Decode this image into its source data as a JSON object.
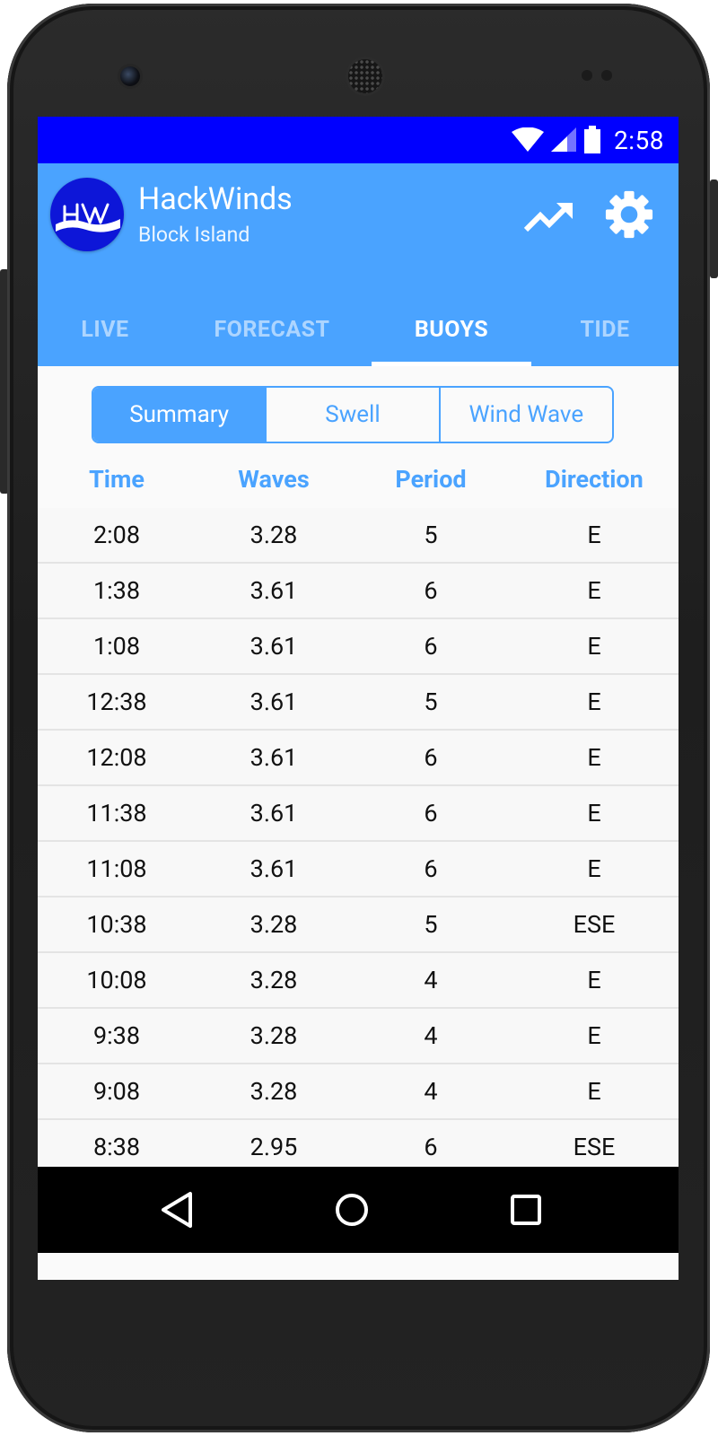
{
  "status_bar": {
    "time": "2:58"
  },
  "app": {
    "title": "HackWinds",
    "subtitle": "Block Island"
  },
  "tabs": [
    {
      "label": "LIVE",
      "active": false
    },
    {
      "label": "FORECAST",
      "active": false
    },
    {
      "label": "BUOYS",
      "active": true
    },
    {
      "label": "TIDE",
      "active": false
    }
  ],
  "segments": [
    {
      "label": "Summary",
      "active": true
    },
    {
      "label": "Swell",
      "active": false
    },
    {
      "label": "Wind Wave",
      "active": false
    }
  ],
  "table": {
    "headers": [
      "Time",
      "Waves",
      "Period",
      "Direction"
    ],
    "rows": [
      [
        "2:08",
        "3.28",
        "5",
        "E"
      ],
      [
        "1:38",
        "3.61",
        "6",
        "E"
      ],
      [
        "1:08",
        "3.61",
        "6",
        "E"
      ],
      [
        "12:38",
        "3.61",
        "5",
        "E"
      ],
      [
        "12:08",
        "3.61",
        "6",
        "E"
      ],
      [
        "11:38",
        "3.61",
        "6",
        "E"
      ],
      [
        "11:08",
        "3.61",
        "6",
        "E"
      ],
      [
        "10:38",
        "3.28",
        "5",
        "ESE"
      ],
      [
        "10:08",
        "3.28",
        "4",
        "E"
      ],
      [
        "9:38",
        "3.28",
        "4",
        "E"
      ],
      [
        "9:08",
        "3.28",
        "4",
        "E"
      ],
      [
        "8:38",
        "2.95",
        "6",
        "ESE"
      ]
    ]
  },
  "colors": {
    "status_bar": "#0000ff",
    "primary": "#4aa3ff",
    "background": "#fafafa"
  },
  "icons": {
    "status": [
      "wifi-icon",
      "signal-icon",
      "battery-icon"
    ],
    "actions": [
      "trending-up-icon",
      "settings-gear-icon"
    ],
    "nav": [
      "back-icon",
      "home-icon",
      "recents-icon"
    ]
  }
}
